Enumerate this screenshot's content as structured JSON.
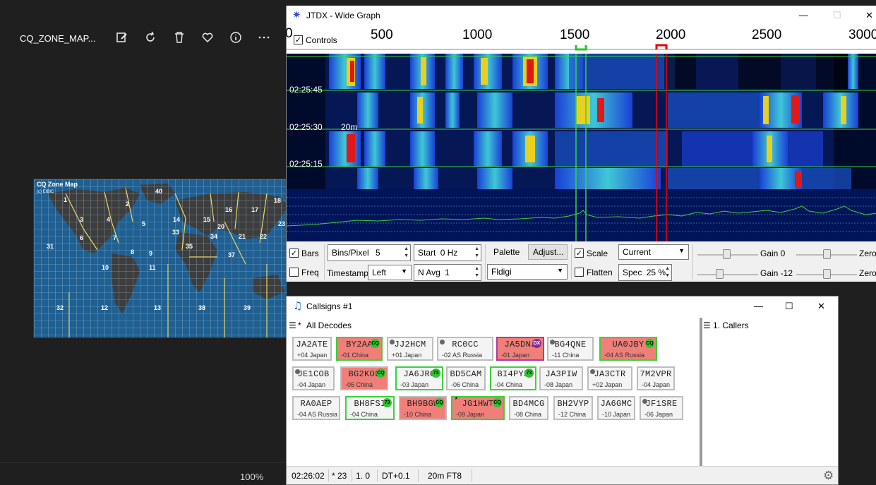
{
  "viewer": {
    "title": "CQ_ZONE_MAP...",
    "zoom": "100%",
    "toolbar_icons": [
      "edit-icon",
      "rotate-icon",
      "delete-icon",
      "favorite-icon",
      "info-icon",
      "more-icon"
    ]
  },
  "cqmap": {
    "title": "CQ Zone Map",
    "copyright": "(c) EIBIC",
    "zones": [
      "1",
      "2",
      "3",
      "4",
      "5",
      "6",
      "7",
      "8",
      "9",
      "10",
      "11",
      "12",
      "13",
      "14",
      "15",
      "16",
      "17",
      "18",
      "20",
      "21",
      "22",
      "23",
      "31",
      "32",
      "33",
      "34",
      "35",
      "37",
      "38",
      "39",
      "40"
    ]
  },
  "widegraph": {
    "title": "JTDX - Wide Graph",
    "controls_label": "Controls",
    "freq_ticks": [
      "500",
      "1000",
      "1500",
      "2000",
      "2500",
      "3000"
    ],
    "first_tick": "0",
    "timestamps": [
      "02:25:45",
      "02:25:30",
      "02:25:15"
    ],
    "band_label": "20m",
    "bars_label": "Bars",
    "freq_label": "Freq",
    "bins_per_pixel_label": "Bins/Pixel",
    "bins_per_pixel_value": "5",
    "start_label": "Start",
    "start_value": "0 Hz",
    "timestamp_label": "Timestamp",
    "timestamp_value": "Left",
    "navg_label": "N Avg",
    "navg_value": "1",
    "palette_label": "Palette",
    "adjust_label": "Adjust...",
    "palette_value": "Fldigi",
    "scale_label": "Scale",
    "flatten_label": "Flatten",
    "mode_value": "Current",
    "spec_label": "Spec",
    "spec_value": "25 %",
    "gain1_label": "Gain  0",
    "gain2_label": "Gain  -12",
    "zero1_label": "Zero",
    "zero2_label": "Zero"
  },
  "callsigns": {
    "title": "Callsigns #1",
    "all_decodes_label": "All Decodes",
    "callers_label": "1.  Callers",
    "tiles": [
      {
        "call": "JA2ATE",
        "info": "+04 Japan",
        "style": "plain",
        "mark": "none",
        "badge": ""
      },
      {
        "call": "BY2AA",
        "info": "-01 China",
        "style": "red-green",
        "mark": "none",
        "badge": "CQ"
      },
      {
        "call": "JJ2HCM",
        "info": "+01 Japan",
        "style": "plain",
        "mark": "dot",
        "badge": ""
      },
      {
        "call": "RC0CC",
        "info": "-02 AS Russia",
        "style": "plain",
        "mark": "dot",
        "badge": ""
      },
      {
        "call": "JA5DNJ",
        "info": "-01 Japan",
        "style": "red-purple",
        "mark": "none",
        "badge": "DX"
      },
      {
        "call": "BG4QNE",
        "info": "-11 China",
        "style": "plain",
        "mark": "dot",
        "badge": ""
      },
      {
        "call": "UA0JBY",
        "info": "-04 AS Russia",
        "style": "red-green",
        "mark": "none",
        "badge": "CQ"
      },
      {
        "call": "JE1COB",
        "info": "-04 Japan",
        "style": "plain",
        "mark": "dot",
        "badge": ""
      },
      {
        "call": "BG2KOL",
        "info": "-05 China",
        "style": "red-gray",
        "mark": "none",
        "badge": "CQ"
      },
      {
        "call": "JA6JRG",
        "info": "-03 Japan",
        "style": "plain-green",
        "mark": "none",
        "badge": "73"
      },
      {
        "call": "BD5CAM",
        "info": "-06 China",
        "style": "plain",
        "mark": "none",
        "badge": ""
      },
      {
        "call": "BI4PYF",
        "info": "-04 China",
        "style": "plain-green",
        "mark": "none",
        "badge": "73"
      },
      {
        "call": "JA3PIW",
        "info": "-08 Japan",
        "style": "plain",
        "mark": "none",
        "badge": ""
      },
      {
        "call": "JA3CTR",
        "info": "+02 Japan",
        "style": "plain",
        "mark": "dot",
        "badge": ""
      },
      {
        "call": "7M2VPR",
        "info": "-04 Japan",
        "style": "plain",
        "mark": "none",
        "badge": ""
      },
      {
        "call": "RA0AEP",
        "info": "-04 AS Russia",
        "style": "plain",
        "mark": "none",
        "badge": ""
      },
      {
        "call": "BH8FSI",
        "info": "-04 China",
        "style": "plain-green",
        "mark": "none",
        "badge": "73"
      },
      {
        "call": "BH9BGW",
        "info": "-10 China",
        "style": "red-gray",
        "mark": "none",
        "badge": "CQ"
      },
      {
        "call": "JG1HWT",
        "info": "-09 Japan",
        "style": "red-green",
        "mark": "star",
        "badge": "CQ"
      },
      {
        "call": "BD4MCG",
        "info": "-08 China",
        "style": "plain",
        "mark": "none",
        "badge": ""
      },
      {
        "call": "BH2VYP",
        "info": "-12 China",
        "style": "plain",
        "mark": "none",
        "badge": ""
      },
      {
        "call": "JA6GMC",
        "info": "-10 Japan",
        "style": "plain",
        "mark": "none",
        "badge": ""
      },
      {
        "call": "JF1SRE",
        "info": "-06 Japan",
        "style": "plain",
        "mark": "dot",
        "badge": ""
      }
    ],
    "status": {
      "time": "02:26:02",
      "count": "* 23",
      "field3": "1.   0",
      "dt": "DT+0.1",
      "mode": "20m FT8"
    }
  },
  "colors": {
    "accent_green": "#2ac52a",
    "tile_red": "#f07f7a",
    "dx_purple": "#8a2a9a"
  }
}
